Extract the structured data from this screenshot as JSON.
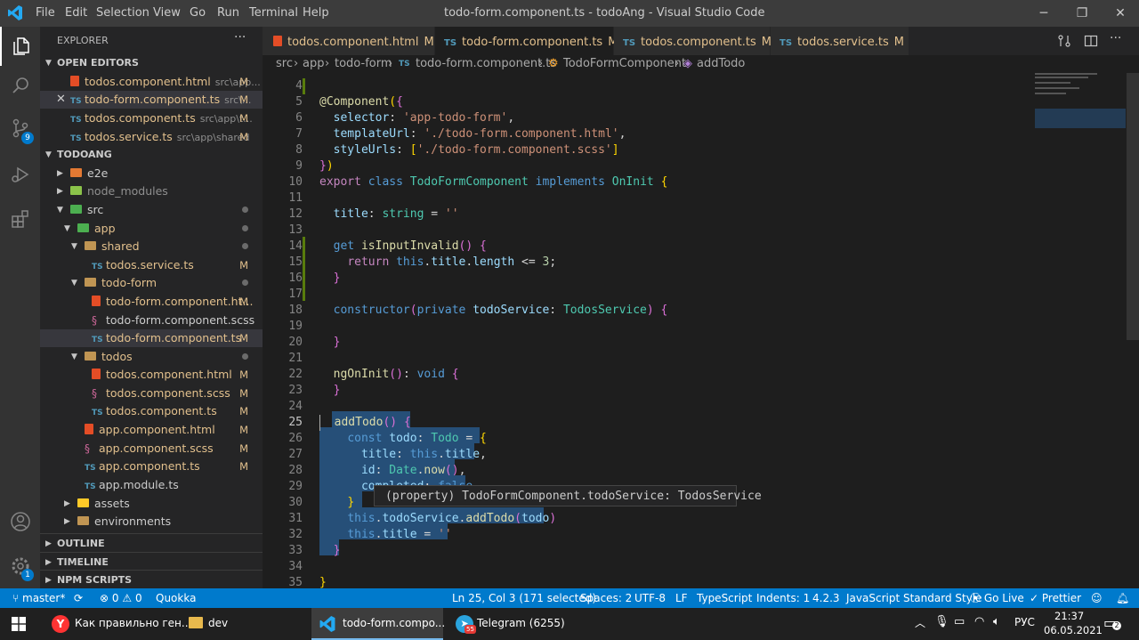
{
  "titlebar": {
    "title": "todo-form.component.ts - todoAng - Visual Studio Code",
    "menu": [
      "File",
      "Edit",
      "Selection",
      "View",
      "Go",
      "Run",
      "Terminal",
      "Help"
    ]
  },
  "sidebar": {
    "header": "EXPLORER",
    "more": "···",
    "open_editors_label": "OPEN EDITORS",
    "open_editors": [
      {
        "name": "todos.component.html",
        "desc": "src\\app...",
        "badge": "M"
      },
      {
        "name": "todo-form.component.ts",
        "desc": "src\\...",
        "badge": "M"
      },
      {
        "name": "todos.component.ts",
        "desc": "src\\app\\t...",
        "badge": "M"
      },
      {
        "name": "todos.service.ts",
        "desc": "src\\app\\shared",
        "badge": "M"
      }
    ],
    "project_label": "TODOANG",
    "tree": [
      {
        "name": "e2e"
      },
      {
        "name": "node_modules"
      },
      {
        "name": "src"
      },
      {
        "name": "app"
      },
      {
        "name": "shared"
      },
      {
        "name": "todos.service.ts",
        "badge": "M"
      },
      {
        "name": "todo-form"
      },
      {
        "name": "todo-form.component.ht...",
        "badge": "M"
      },
      {
        "name": "todo-form.component.scss"
      },
      {
        "name": "todo-form.component.ts",
        "badge": "M"
      },
      {
        "name": "todos"
      },
      {
        "name": "todos.component.html",
        "badge": "M"
      },
      {
        "name": "todos.component.scss",
        "badge": "M"
      },
      {
        "name": "todos.component.ts",
        "badge": "M"
      },
      {
        "name": "app.component.html",
        "badge": "M"
      },
      {
        "name": "app.component.scss",
        "badge": "M"
      },
      {
        "name": "app.component.ts",
        "badge": "M"
      },
      {
        "name": "app.module.ts"
      },
      {
        "name": "assets"
      },
      {
        "name": "environments"
      }
    ],
    "outline_label": "OUTLINE",
    "timeline_label": "TIMELINE",
    "npm_label": "NPM SCRIPTS"
  },
  "activity": {
    "scm_badge": "9",
    "settings_badge": "1"
  },
  "tabs": [
    {
      "name": "todos.component.html",
      "mod": "M"
    },
    {
      "name": "todo-form.component.ts",
      "mod": "M"
    },
    {
      "name": "todos.component.ts",
      "mod": "M"
    },
    {
      "name": "todos.service.ts",
      "mod": "M"
    }
  ],
  "breadcrumb": [
    "src",
    "app",
    "todo-form",
    "todo-form.component.ts",
    "TodoFormComponent",
    "addTodo"
  ],
  "editor": {
    "line_numbers": [
      "4",
      "5",
      "6",
      "7",
      "8",
      "9",
      "10",
      "11",
      "12",
      "13",
      "14",
      "15",
      "16",
      "17",
      "18",
      "19",
      "20",
      "21",
      "22",
      "23",
      "24",
      "25",
      "26",
      "27",
      "28",
      "29",
      "30",
      "31",
      "32",
      "33",
      "34",
      "35"
    ],
    "hover": "(property) TodoFormComponent.todoService: TodosService"
  },
  "statusbar": {
    "branch": "master*",
    "errors": "0",
    "warnings": "0",
    "quokka": "Quokka",
    "position": "Ln 25, Col 3 (171 selected)",
    "spaces": "Spaces: 2",
    "encoding": "UTF-8",
    "eol": "LF",
    "language": "TypeScript",
    "indents": "Indents: 1",
    "version": "4.2.3",
    "style": "JavaScript Standard Style",
    "golive": "Go Live",
    "prettier": "Prettier"
  },
  "taskbar": {
    "items": [
      "Как правильно ген...",
      "dev",
      "todo-form.compo...",
      "Telegram (6255)"
    ],
    "telegram_badge": "55",
    "lang": "РУС",
    "time": "21:37",
    "date": "06.05.2021",
    "notif": "2"
  }
}
